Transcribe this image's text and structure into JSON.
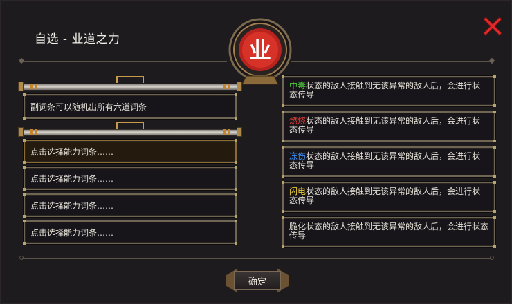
{
  "dialog": {
    "title": "自选 - 业道之力",
    "emblem_char": "业",
    "close_icon": "close-x-icon",
    "accent_color": "#e8303a"
  },
  "left_panel": {
    "info_text": "副词条可以随机出所有六道词条",
    "slots": [
      {
        "label": "点击选择能力词条……",
        "selected": true
      },
      {
        "label": "点击选择能力词条……",
        "selected": false
      },
      {
        "label": "点击选择能力词条……",
        "selected": false
      },
      {
        "label": "点击选择能力词条……",
        "selected": false
      }
    ]
  },
  "right_panel": {
    "options": [
      {
        "keyword": "中毒",
        "keyword_color": "#4cd13a",
        "text": "状态的敌人接触到无该异常的敌人后，会进行状态传导"
      },
      {
        "keyword": "燃烧",
        "keyword_color": "#e8413a",
        "text": "状态的敌人接触到无该异常的敌人后，会进行状态传导"
      },
      {
        "keyword": "冻伤",
        "keyword_color": "#3c8ef0",
        "text": "状态的敌人接触到无该异常的敌人后，会进行状态传导"
      },
      {
        "keyword": "闪电",
        "keyword_color": "#e8c83a",
        "text": "状态的敌人接触到无该异常的敌人后，会进行状态传导"
      },
      {
        "keyword": "",
        "keyword_color": "#e6e1d8",
        "text": "脆化状态的敌人接触到无该异常的敌人后，会进行状态传导"
      }
    ]
  },
  "footer": {
    "confirm_label": "确定"
  }
}
